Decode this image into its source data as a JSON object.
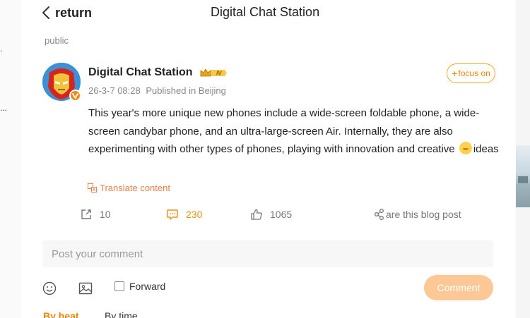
{
  "header": {
    "back_label": "return",
    "title": "Digital Chat Station"
  },
  "visibility": "public",
  "post": {
    "author": "Digital Chat Station",
    "level": "IV",
    "datetime": "26-3-7 08:28",
    "location": "Published in Beijing",
    "follow_label": "focus on",
    "body_part1": "This year's more unique new phones include a wide-screen foldable phone, a wide-screen candybar phone, and an ultra-large-screen Air. Internally, they are also experimenting with other types of phones, playing with innovation and creative ",
    "body_part2": "ideas",
    "translate_label": "Translate content"
  },
  "actions": {
    "repost_count": "10",
    "comment_count": "230",
    "like_count": "1065",
    "share_label": "are this blog post"
  },
  "composer": {
    "placeholder": "Post your comment",
    "forward_label": "Forward",
    "submit_label": "Comment"
  },
  "sort": {
    "by_heat": "By heat",
    "by_time": "By time"
  },
  "colors": {
    "accent": "#f08300",
    "comment_button": "#fdc896",
    "translate": "#e8804a"
  },
  "icons": {
    "back": "chevron-left-icon",
    "repost": "repost-icon",
    "comment": "comment-icon",
    "like": "thumbs-up-icon",
    "share": "share-icon",
    "emoji": "smiley-icon",
    "image": "image-icon",
    "translate": "translate-icon",
    "verified": "verified-icon",
    "level": "crown-level-icon"
  }
}
